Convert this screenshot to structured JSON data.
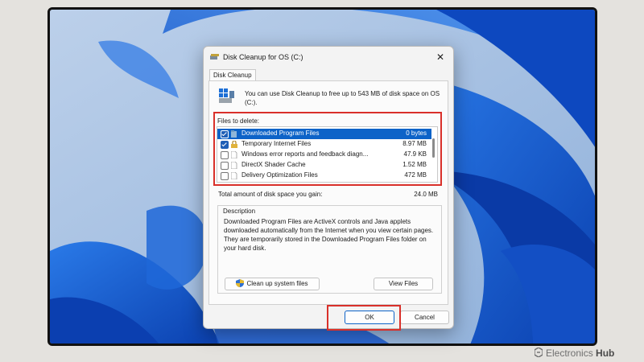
{
  "window": {
    "title": "Disk Cleanup for OS (C:)",
    "close_label": "✕"
  },
  "tab": {
    "label": "Disk Cleanup"
  },
  "intro_text": "You can use Disk Cleanup to free up to 543 MB of disk space on OS (C:).",
  "files": {
    "label": "Files to delete:",
    "items": [
      {
        "name": "Downloaded Program Files",
        "size": "0 bytes",
        "checked": true,
        "selected": true,
        "icon": "folder-icon"
      },
      {
        "name": "Temporary Internet Files",
        "size": "8.97 MB",
        "checked": true,
        "selected": false,
        "icon": "lock-icon"
      },
      {
        "name": "Windows error reports and feedback diagn...",
        "size": "47.9 KB",
        "checked": false,
        "selected": false,
        "icon": "file-icon"
      },
      {
        "name": "DirectX Shader Cache",
        "size": "1.52 MB",
        "checked": false,
        "selected": false,
        "icon": "file-icon"
      },
      {
        "name": "Delivery Optimization Files",
        "size": "472 MB",
        "checked": false,
        "selected": false,
        "icon": "file-icon"
      }
    ]
  },
  "total": {
    "label": "Total amount of disk space you gain:",
    "value": "24.0 MB"
  },
  "description": {
    "title": "Description",
    "text": "Downloaded Program Files are ActiveX controls and Java applets downloaded automatically from the Internet when you view certain pages. They are temporarily stored in the Downloaded Program Files folder on your hard disk."
  },
  "buttons": {
    "cleanup": "Clean up system files",
    "view": "View Files",
    "ok": "OK",
    "cancel": "Cancel"
  },
  "watermark": {
    "brand": "Electronics",
    "brand_bold": "Hub"
  },
  "colors": {
    "highlight": "#d9302a",
    "selection": "#0d63c8",
    "checkbox_checked": "#1f5fb6",
    "wallpaper_bloom": "#0a4fc7"
  }
}
